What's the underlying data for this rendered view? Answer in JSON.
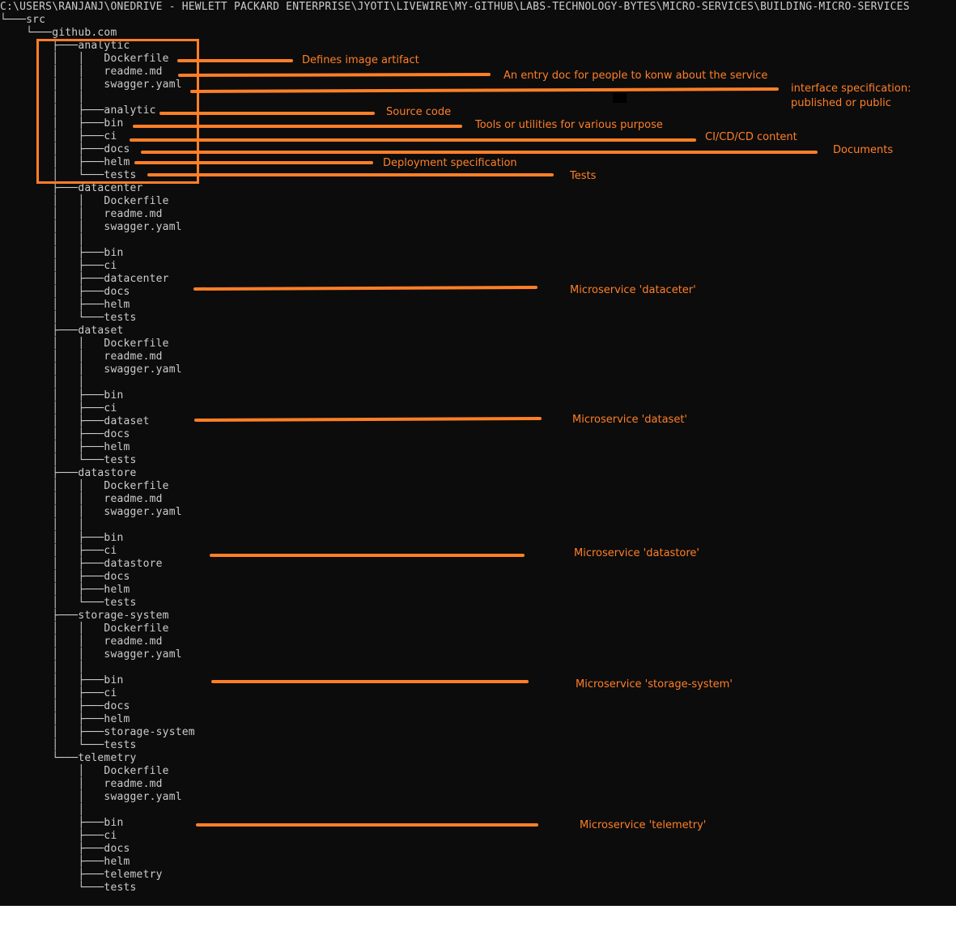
{
  "terminal": {
    "path": "C:\\USERS\\RANJANJ\\ONEDRIVE - HEWLETT PACKARD ENTERPRISE\\JYOTI\\LIVEWIRE\\MY-GITHUB\\LABS-TECHNOLOGY-BYTES\\MICRO-SERVICES\\BUILDING-MICRO-SERVICES",
    "tree": [
      "└───src",
      "    └───github.com",
      "        ├───analytic",
      "        │   │   Dockerfile",
      "        │   │   readme.md",
      "        │   │   swagger.yaml",
      "        │   │",
      "        │   ├───analytic",
      "        │   ├───bin",
      "        │   ├───ci",
      "        │   ├───docs",
      "        │   ├───helm",
      "        │   └───tests",
      "        ├───datacenter",
      "        │   │   Dockerfile",
      "        │   │   readme.md",
      "        │   │   swagger.yaml",
      "        │   │",
      "        │   ├───bin",
      "        │   ├───ci",
      "        │   ├───datacenter",
      "        │   ├───docs",
      "        │   ├───helm",
      "        │   └───tests",
      "        ├───dataset",
      "        │   │   Dockerfile",
      "        │   │   readme.md",
      "        │   │   swagger.yaml",
      "        │   │",
      "        │   ├───bin",
      "        │   ├───ci",
      "        │   ├───dataset",
      "        │   ├───docs",
      "        │   ├───helm",
      "        │   └───tests",
      "        ├───datastore",
      "        │   │   Dockerfile",
      "        │   │   readme.md",
      "        │   │   swagger.yaml",
      "        │   │",
      "        │   ├───bin",
      "        │   ├───ci",
      "        │   ├───datastore",
      "        │   ├───docs",
      "        │   ├───helm",
      "        │   └───tests",
      "        ├───storage-system",
      "        │   │   Dockerfile",
      "        │   │   readme.md",
      "        │   │   swagger.yaml",
      "        │   │",
      "        │   ├───bin",
      "        │   ├───ci",
      "        │   ├───docs",
      "        │   ├───helm",
      "        │   ├───storage-system",
      "        │   └───tests",
      "        └───telemetry",
      "            │   Dockerfile",
      "            │   readme.md",
      "            │   swagger.yaml",
      "            │",
      "            ├───bin",
      "            ├───ci",
      "            ├───docs",
      "            ├───helm",
      "            ├───telemetry",
      "            └───tests"
    ]
  },
  "annotations": {
    "dockerfile": "Defines image artifact",
    "readme": "An entry doc for people to konw about the service",
    "swagger_line1": "interface specification:",
    "swagger_line2": "published or public",
    "source": "Source code",
    "bin": "Tools or utilities for various purpose",
    "ci": "CI/CD/CD content",
    "docs": "Documents",
    "helm": "Deployment specification",
    "tests": "Tests",
    "ms_datacenter": "Microservice 'dataceter'",
    "ms_dataset": "Microservice 'dataset'",
    "ms_datastore": "Microservice 'datastore'",
    "ms_storage": "Microservice 'storage-system'",
    "ms_telemetry": "Microservice 'telemetry'"
  },
  "colors": {
    "terminal_bg": "#0c0c0c",
    "terminal_text": "#cccccc",
    "annotation": "#ff7f27"
  }
}
